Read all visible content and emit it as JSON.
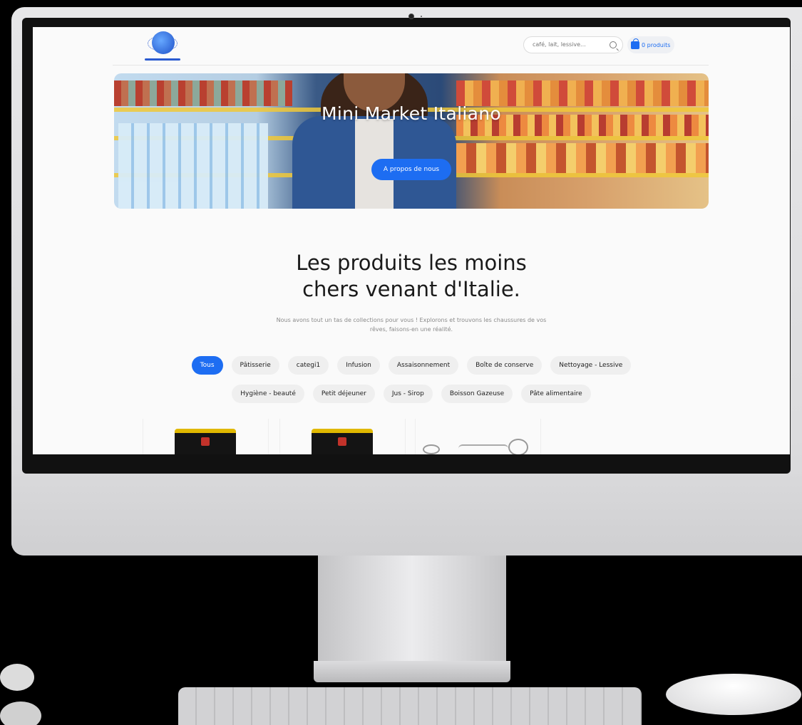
{
  "header": {
    "search_placeholder": "café, lait, lessive...",
    "cart_label": "0 produits"
  },
  "hero": {
    "title": "Mini Market Italiano",
    "button_label": "A propos de nous"
  },
  "section": {
    "headline_line1": "Les produits les moins",
    "headline_line2": "chers venant d'Italie.",
    "intro_line1": "Nous avons tout un tas de collections pour vous ! Explorons et trouvons les chaussures de vos",
    "intro_line2": "rêves, faisons-en une réalité."
  },
  "categories": {
    "row1": [
      "Tous",
      "Pâtisserie",
      "categi1",
      "Infusion",
      "Assaisonnement",
      "Boîte de conserve",
      "Nettoyage - Lessive"
    ],
    "row2": [
      "Hygiène - beauté",
      "Petit déjeuner",
      "Jus - Sirop",
      "Boisson Gazeuse",
      "Pâte alimentaire"
    ],
    "active": "Tous"
  },
  "colors": {
    "accent": "#1d6df2",
    "chip_bg": "#efefef",
    "page_bg": "#fafafa"
  },
  "icons": {
    "search": "search-icon",
    "cart": "shopping-bag-icon",
    "logo": "globe-logo"
  }
}
